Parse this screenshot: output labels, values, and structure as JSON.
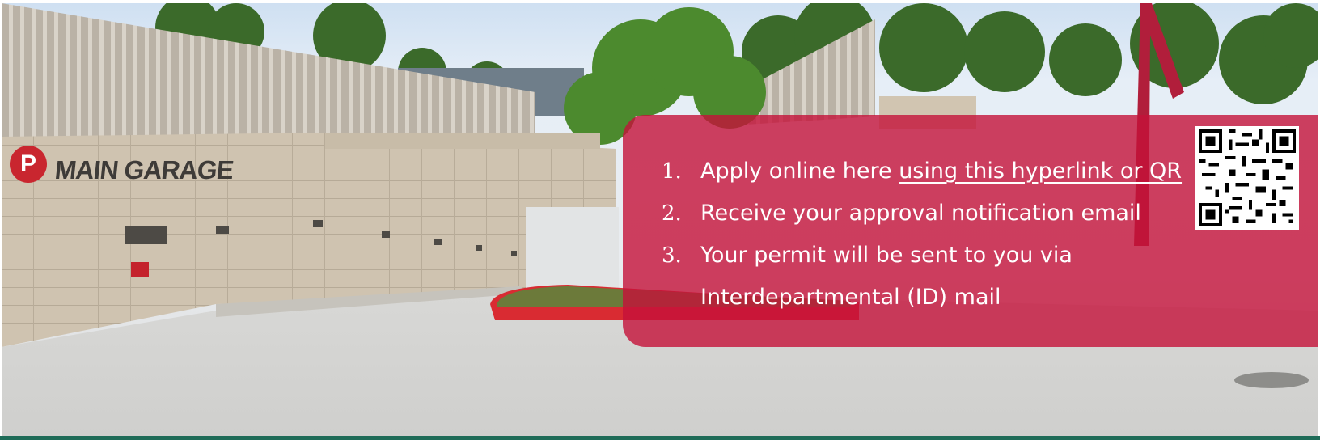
{
  "signage": {
    "garage_name": "MAIN GARAGE",
    "parking_icon_letter": "P"
  },
  "steps": [
    {
      "number": "1.",
      "text_before_link": "Apply online here ",
      "link_text": "using this hyperlink or QR"
    },
    {
      "number": "2.",
      "text": "Receive your approval notification email"
    },
    {
      "number": "3.",
      "text": "Your permit will be sent to you via",
      "text_cont": "Interdepartmental (ID) mail"
    }
  ],
  "colors": {
    "panel": "#c4123a",
    "accent_bar": "#1e6b57",
    "text": "#ffffff"
  },
  "icons": {
    "qr": "qr-code-icon",
    "parking": "parking-sign-icon"
  }
}
